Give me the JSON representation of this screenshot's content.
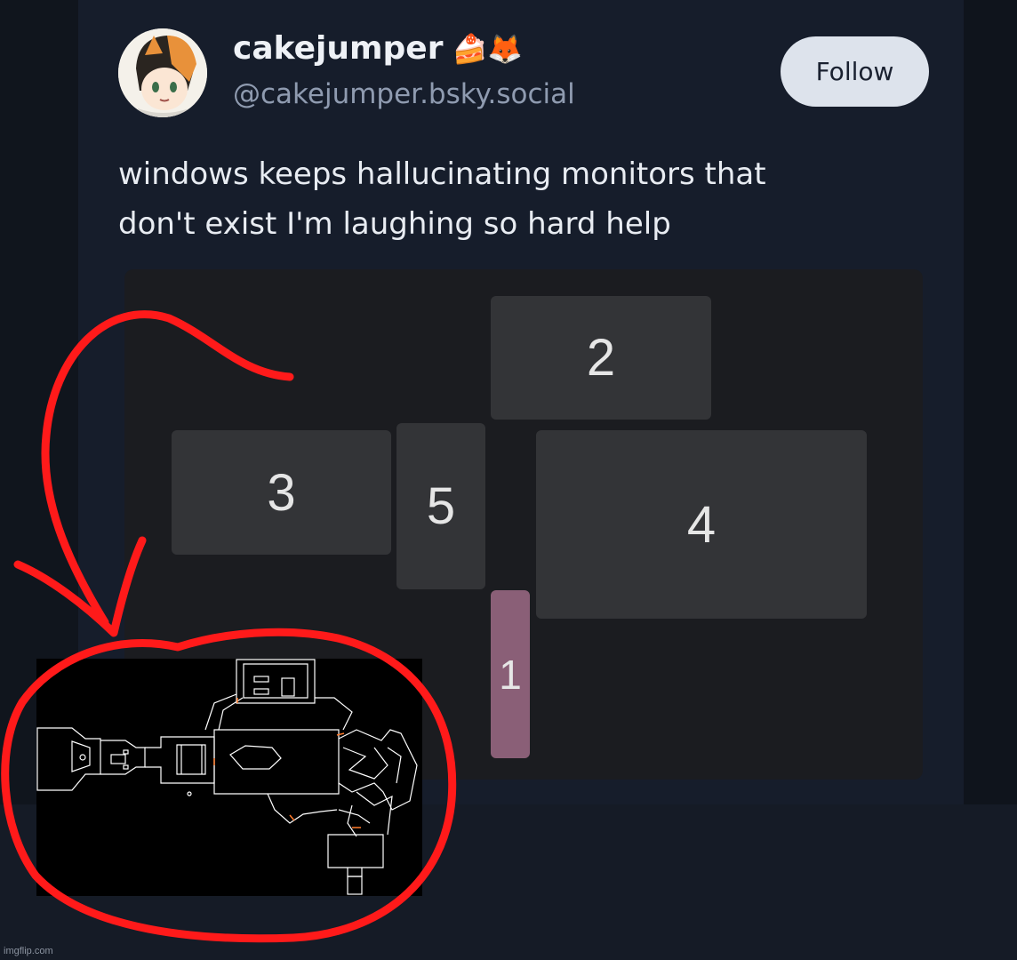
{
  "post": {
    "display_name": "cakejumper",
    "name_emojis": "🍰🦊",
    "handle": "@cakejumper.bsky.social",
    "follow_label": "Follow",
    "text_line1": "windows keeps hallucinating monitors that",
    "text_line2": "don't exist I'm laughing so hard help"
  },
  "monitors": [
    {
      "label": "2"
    },
    {
      "label": "3"
    },
    {
      "label": "5"
    },
    {
      "label": "4"
    },
    {
      "label": "1"
    }
  ],
  "colors": {
    "background": "#151b26",
    "monitor": "#333437",
    "monitor_primary": "#8a5f77",
    "scribble": "#ff0000",
    "map_line": "#ffffff",
    "map_accent": "#ff7a2a"
  },
  "watermark": "imgflip.com"
}
